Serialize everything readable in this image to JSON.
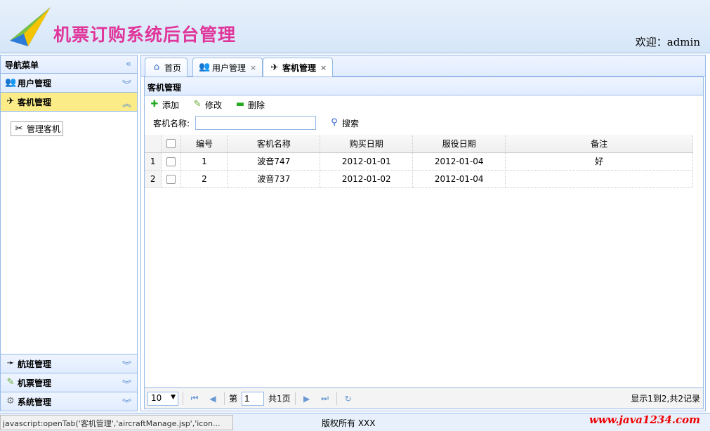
{
  "header": {
    "title": "机票订购系统后台管理",
    "welcome": "欢迎：admin"
  },
  "nav": {
    "title": "导航菜单",
    "sections": [
      {
        "label": "用户管理",
        "icon": "users-icon",
        "state": "collapsed"
      },
      {
        "label": "客机管理",
        "icon": "airplane-icon",
        "state": "expanded",
        "items": [
          "管理客机"
        ]
      },
      {
        "label": "航班管理",
        "icon": "flight-icon",
        "state": "collapsed"
      },
      {
        "label": "机票管理",
        "icon": "ticket-icon",
        "state": "collapsed"
      },
      {
        "label": "系统管理",
        "icon": "gear-icon",
        "state": "collapsed"
      }
    ]
  },
  "tabs": [
    {
      "label": "首页",
      "icon": "home-icon",
      "closable": false
    },
    {
      "label": "用户管理",
      "icon": "users-icon",
      "closable": true
    },
    {
      "label": "客机管理",
      "icon": "airplane-icon",
      "closable": true,
      "selected": true
    }
  ],
  "panel": {
    "title": "客机管理",
    "toolbar": {
      "add": "添加",
      "edit": "修改",
      "delete": "删除"
    },
    "search": {
      "label": "客机名称:",
      "value": "",
      "button": "搜索"
    }
  },
  "grid": {
    "columns": [
      "编号",
      "客机名称",
      "购买日期",
      "服役日期",
      "备注"
    ],
    "rows": [
      {
        "rownum": "1",
        "id": "1",
        "name": "波音747",
        "buy": "2012-01-01",
        "service": "2012-01-04",
        "remark": "好"
      },
      {
        "rownum": "2",
        "id": "2",
        "name": "波音737",
        "buy": "2012-01-02",
        "service": "2012-01-04",
        "remark": ""
      }
    ]
  },
  "pager": {
    "page_size": "10",
    "page_prefix": "第",
    "page": "1",
    "page_suffix": "共1页",
    "info": "显示1到2,共2记录"
  },
  "footer": {
    "status": "javascript:openTab('客机管理','aircraftManage.jsp','icon...",
    "copyright": "版权所有 XXX",
    "watermark": "www.java1234.com"
  },
  "colors": {
    "border": "#95b8e7",
    "title": "#e0359a",
    "active_section": "#fbec88"
  }
}
